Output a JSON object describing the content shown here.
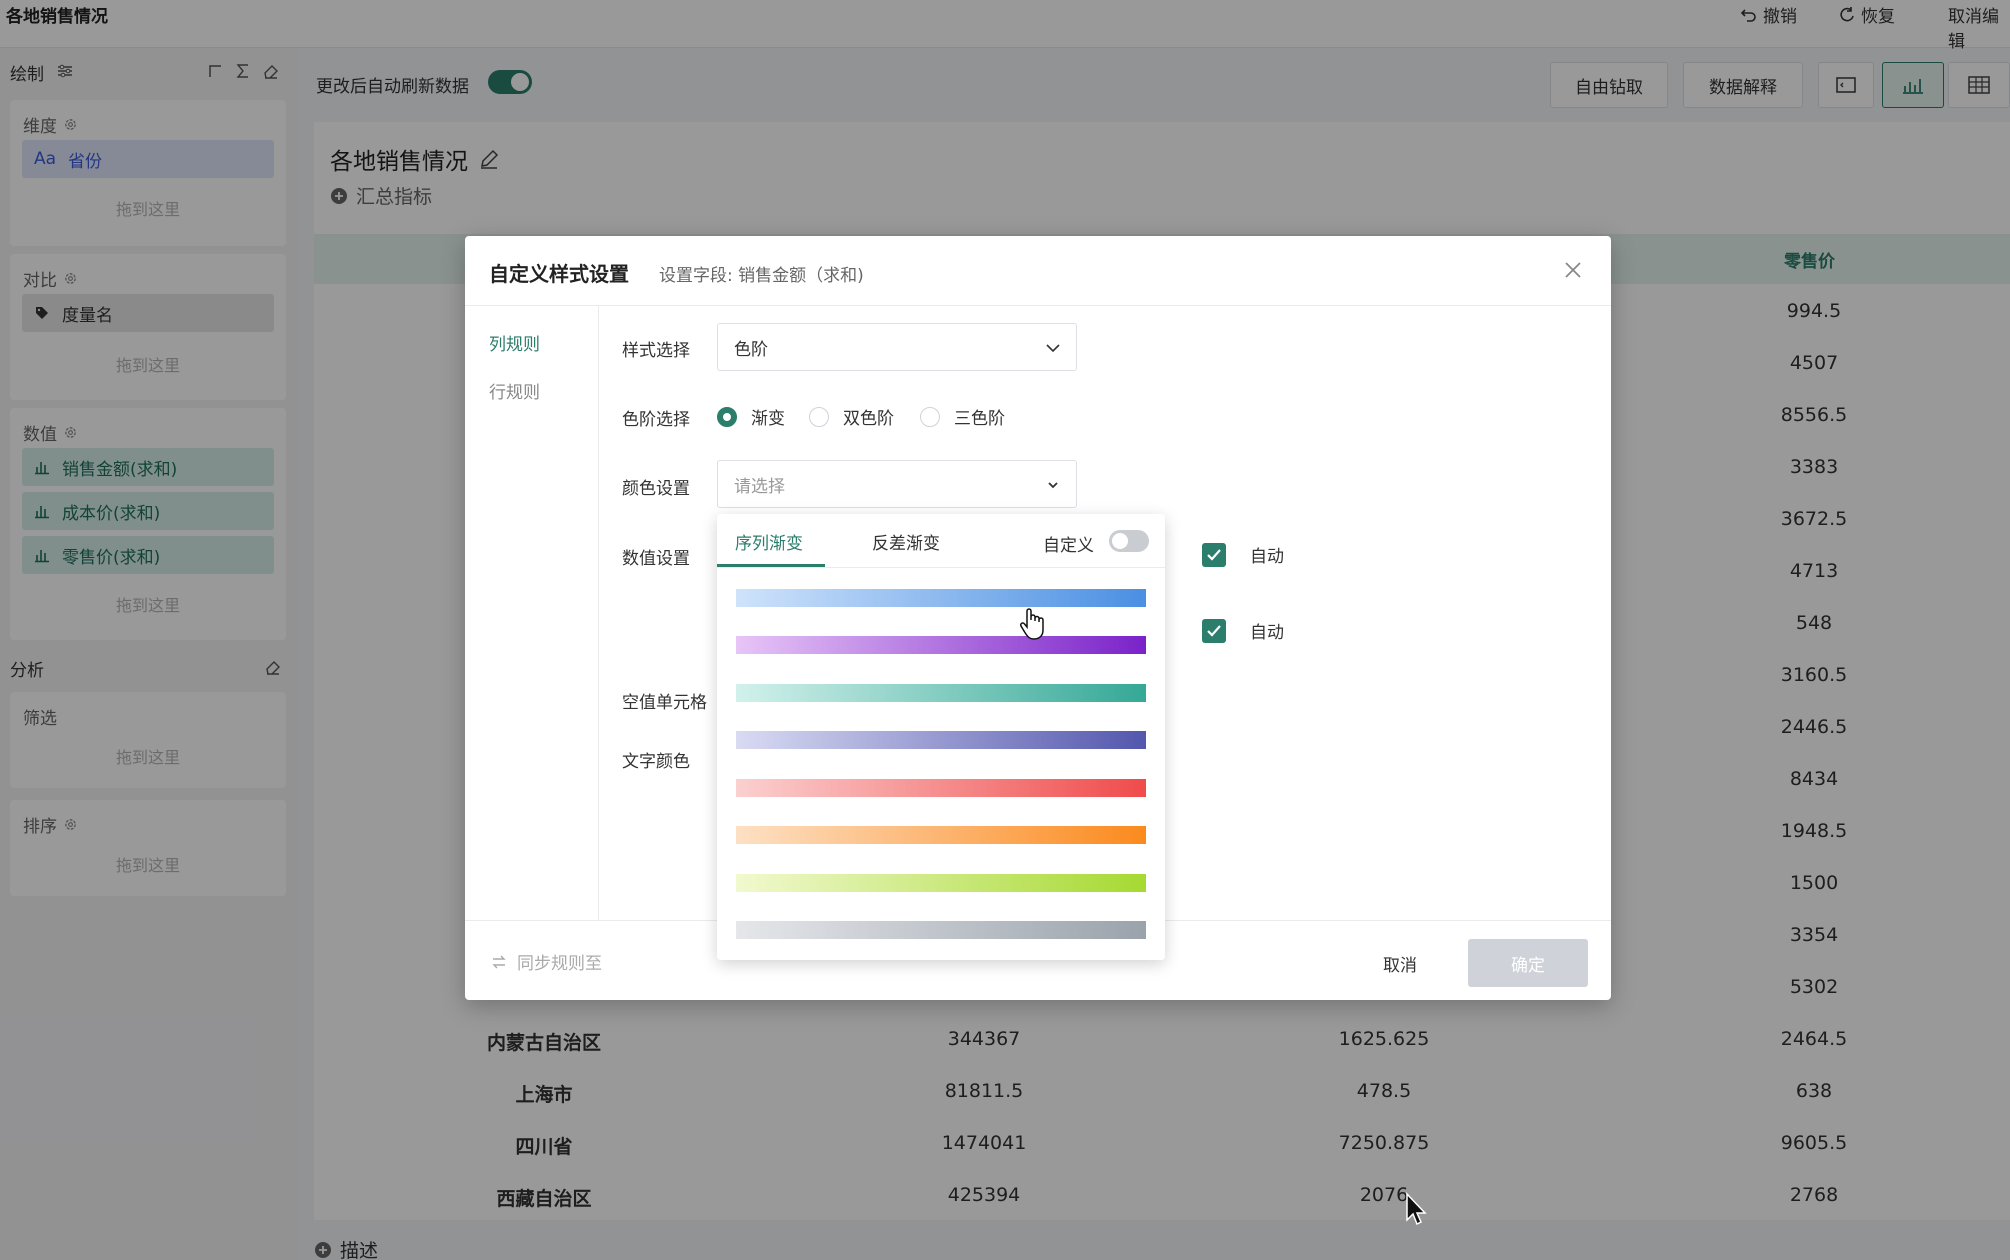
{
  "app": {
    "title": "各地销售情况",
    "actions": [
      "撤销",
      "恢复",
      "取消编辑"
    ]
  },
  "left_panel": {
    "draw_label": "绘制",
    "dimension": {
      "title": "维度",
      "field": "省份",
      "field_prefix": "Aa",
      "drop": "拖到这里"
    },
    "compare": {
      "title": "对比",
      "field": "度量名",
      "drop": "拖到这里"
    },
    "values": {
      "title": "数值",
      "fields": [
        "销售金额(求和)",
        "成本价(求和)",
        "零售价(求和)"
      ],
      "drop": "拖到这里"
    },
    "analysis_label": "分析",
    "filter": {
      "title": "筛选",
      "drop": "拖到这里"
    },
    "sort": {
      "title": "排序",
      "drop": "拖到这里"
    }
  },
  "toolbar": {
    "auto_refresh_label": "更改后自动刷新数据",
    "auto_refresh_on": true,
    "drill": "自由钻取",
    "explain": "数据解释"
  },
  "main": {
    "chart_title": "各地销售情况",
    "summary": "汇总指标",
    "column_header": "零售价",
    "describe": "描述",
    "retail_values": [
      "994.5",
      "4507",
      "8556.5",
      "3383",
      "3672.5",
      "4713",
      "548",
      "3160.5",
      "2446.5",
      "8434",
      "1948.5",
      "1500",
      "3354",
      "5302",
      "2464.5",
      "638",
      "9605.5",
      "2768"
    ],
    "bottom_rows": [
      {
        "province": "内蒙古自治区",
        "sales": "344367",
        "cost": "1625.625",
        "retail": "2464.5"
      },
      {
        "province": "上海市",
        "sales": "81811.5",
        "cost": "478.5",
        "retail": "638"
      },
      {
        "province": "四川省",
        "sales": "1474041",
        "cost": "7250.875",
        "retail": "9605.5"
      },
      {
        "province": "西藏自治区",
        "sales": "425394",
        "cost": "2076",
        "retail": "2768"
      }
    ]
  },
  "modal": {
    "title": "自定义样式设置",
    "subtitle": "设置字段: 销售金额（求和)",
    "nav": [
      "列规则",
      "行规则"
    ],
    "style_label": "样式选择",
    "style_value": "色阶",
    "scale_label": "色阶选择",
    "scale_options": [
      "渐变",
      "双色阶",
      "三色阶"
    ],
    "scale_selected": 0,
    "color_label": "颜色设置",
    "color_placeholder": "请选择",
    "value_label": "数值设置",
    "auto_label": "自动",
    "empty_label": "空值单元格",
    "text_color_label": "文字颜色",
    "sync_label": "同步规则至",
    "cancel": "取消",
    "ok": "确定"
  },
  "dropdown": {
    "tabs": [
      "序列渐变",
      "反差渐变"
    ],
    "custom_label": "自定义",
    "gradients": [
      [
        "#cfe3fb",
        "#4a8fe3"
      ],
      [
        "#e7c5f7",
        "#7a22c9"
      ],
      [
        "#d2f1ec",
        "#35a896"
      ],
      [
        "#d9dbf3",
        "#5357ad"
      ],
      [
        "#fbd0d0",
        "#f04b4b"
      ],
      [
        "#fde0c4",
        "#fb8a1d"
      ],
      [
        "#f1f9cf",
        "#a6d931"
      ],
      [
        "#e5e7ea",
        "#9aa2ab"
      ]
    ]
  },
  "colors": {
    "accent": "#2b7d6c"
  }
}
